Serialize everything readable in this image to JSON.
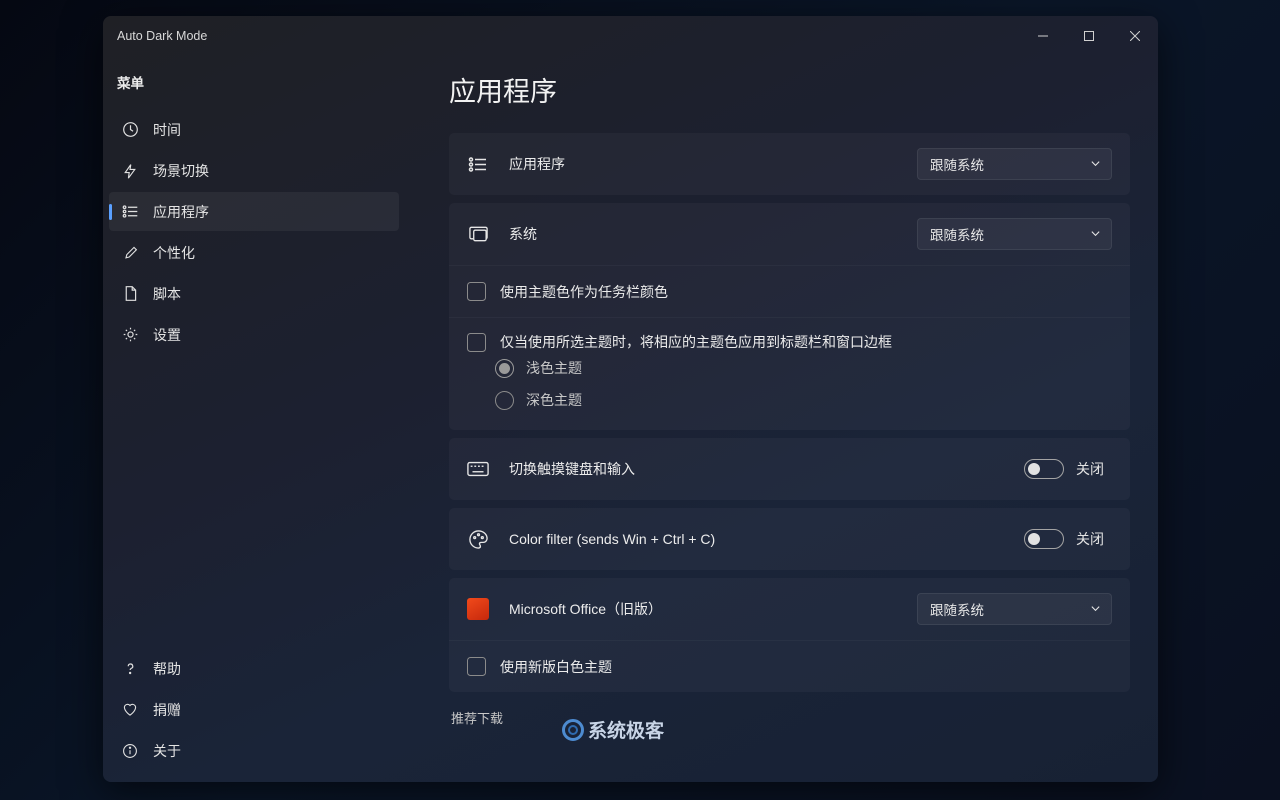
{
  "window": {
    "title": "Auto Dark Mode"
  },
  "sidebar": {
    "menu_label": "菜单",
    "items": [
      {
        "label": "时间"
      },
      {
        "label": "场景切换"
      },
      {
        "label": "应用程序"
      },
      {
        "label": "个性化"
      },
      {
        "label": "脚本"
      },
      {
        "label": "设置"
      }
    ],
    "bottom": [
      {
        "label": "帮助"
      },
      {
        "label": "捐赠"
      },
      {
        "label": "关于"
      }
    ]
  },
  "page": {
    "title": "应用程序",
    "apps_row_label": "应用程序",
    "apps_select": "跟随系统",
    "system_row_label": "系统",
    "system_select": "跟随系统",
    "taskbar_accent": "使用主题色作为任务栏颜色",
    "accent_only_label": "仅当使用所选主题时，将相应的主题色应用到标题栏和窗口边框",
    "light_theme": "浅色主题",
    "dark_theme": "深色主题",
    "touch_kbd": "切换触摸键盘和输入",
    "toggle_off": "关闭",
    "color_filter": "Color filter (sends Win + Ctrl + C)",
    "office_label": "Microsoft Office（旧版）",
    "office_select": "跟随系统",
    "office_white": "使用新版白色主题",
    "recommended": "推荐下载"
  },
  "watermark": "系统极客"
}
